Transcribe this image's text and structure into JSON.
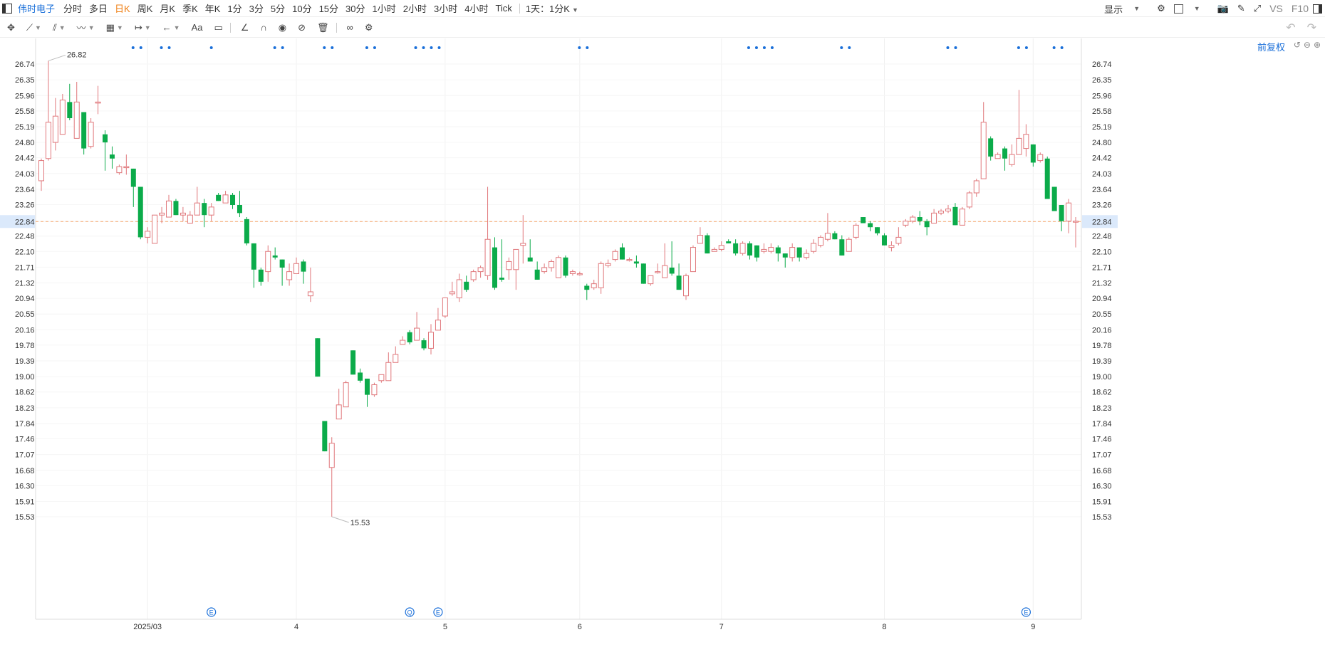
{
  "toolbar": {
    "stock_name": "伟时电子",
    "periods": [
      "分时",
      "多日",
      "日K",
      "周K",
      "月K",
      "季K",
      "年K",
      "1分",
      "3分",
      "5分",
      "10分",
      "15分",
      "30分",
      "1小时",
      "2小时",
      "3小时",
      "4小时",
      "Tick"
    ],
    "active_period": "日K",
    "compare_label": "1天：1分K",
    "display_label": "显示",
    "vs_label": "VS",
    "f10_label": "F10"
  },
  "draw_tools": {
    "text_tool_label": "Aa"
  },
  "adjust_label": "前复权",
  "colors": {
    "up": "#e0777b",
    "down": "#0bab4a",
    "price_line": "#f4a46a",
    "accent": "#1a6fd9",
    "active": "#ef7d10"
  },
  "chart_data": {
    "type": "candlestick",
    "current_price": 22.84,
    "current_price_label": "22.84",
    "high_marker": "26.82",
    "low_marker": "15.53",
    "y_ticks": [
      "26.74",
      "26.35",
      "25.96",
      "25.58",
      "25.19",
      "24.80",
      "24.42",
      "24.03",
      "23.64",
      "23.26",
      "22.84",
      "22.48",
      "22.10",
      "21.71",
      "21.32",
      "20.94",
      "20.55",
      "20.16",
      "19.78",
      "19.39",
      "19.00",
      "18.62",
      "18.23",
      "17.84",
      "17.46",
      "17.07",
      "16.68",
      "16.30",
      "15.91",
      "15.53"
    ],
    "y_range": [
      15.4,
      26.95
    ],
    "x_labels": [
      {
        "label": "2025/03",
        "index": 15
      },
      {
        "label": "4",
        "index": 36
      },
      {
        "label": "5",
        "index": 57
      },
      {
        "label": "6",
        "index": 76
      },
      {
        "label": "7",
        "index": 96
      },
      {
        "label": "8",
        "index": 119
      },
      {
        "label": "9",
        "index": 140
      }
    ],
    "event_markers": [
      {
        "label": "E",
        "index": 24
      },
      {
        "label": "Q",
        "index": 52
      },
      {
        "label": "E",
        "index": 56
      },
      {
        "label": "E",
        "index": 139
      }
    ],
    "dot_groups": [
      [
        13,
        14
      ],
      [
        17,
        18
      ],
      [
        24
      ],
      [
        33,
        34
      ],
      [
        40,
        41
      ],
      [
        46,
        47
      ],
      [
        53,
        54,
        55,
        56
      ],
      [
        76,
        77
      ],
      [
        100,
        101,
        102,
        103
      ],
      [
        113,
        114
      ],
      [
        128,
        129
      ],
      [
        138,
        139
      ],
      [
        143,
        144
      ]
    ],
    "candles": [
      [
        23.85,
        24.35,
        23.6,
        24.4
      ],
      [
        24.4,
        25.3,
        24.35,
        26.82
      ],
      [
        24.8,
        25.45,
        24.6,
        25.9
      ],
      [
        25.0,
        25.85,
        25.0,
        26.0
      ],
      [
        25.8,
        25.4,
        25.35,
        26.25
      ],
      [
        24.9,
        25.8,
        24.9,
        26.3
      ],
      [
        25.55,
        24.65,
        24.5,
        25.55
      ],
      [
        24.7,
        25.3,
        24.65,
        25.4
      ],
      [
        25.8,
        25.8,
        25.5,
        26.2
      ],
      [
        25.0,
        24.8,
        24.1,
        25.1
      ],
      [
        24.5,
        24.4,
        24.15,
        24.7
      ],
      [
        24.05,
        24.2,
        24.0,
        24.25
      ],
      [
        24.2,
        24.2,
        24.0,
        24.5
      ],
      [
        24.15,
        23.7,
        23.2,
        24.15
      ],
      [
        23.7,
        22.45,
        22.4,
        23.7
      ],
      [
        22.45,
        22.6,
        22.3,
        22.7
      ],
      [
        22.3,
        23.0,
        22.3,
        23.0
      ],
      [
        23.0,
        23.05,
        22.8,
        23.2
      ],
      [
        22.95,
        23.35,
        22.95,
        23.5
      ],
      [
        23.35,
        23.0,
        23.0,
        23.4
      ],
      [
        23.0,
        23.05,
        22.85,
        23.2
      ],
      [
        22.8,
        23.0,
        22.8,
        23.1
      ],
      [
        23.0,
        23.3,
        23.0,
        23.7
      ],
      [
        23.3,
        23.0,
        22.7,
        23.4
      ],
      [
        23.0,
        23.2,
        22.85,
        23.3
      ],
      [
        23.5,
        23.35,
        23.35,
        23.55
      ],
      [
        23.3,
        23.5,
        23.3,
        23.6
      ],
      [
        23.5,
        23.25,
        23.15,
        23.55
      ],
      [
        23.25,
        23.05,
        22.95,
        23.6
      ],
      [
        22.9,
        22.3,
        22.25,
        22.95
      ],
      [
        22.3,
        21.65,
        21.2,
        22.3
      ],
      [
        21.65,
        21.35,
        21.25,
        21.7
      ],
      [
        21.6,
        22.1,
        21.35,
        22.25
      ],
      [
        22.0,
        21.95,
        21.9,
        22.2
      ],
      [
        21.9,
        21.7,
        21.25,
        21.9
      ],
      [
        21.4,
        21.6,
        21.25,
        21.8
      ],
      [
        21.55,
        21.8,
        21.55,
        21.95
      ],
      [
        21.85,
        21.6,
        21.3,
        21.9
      ],
      [
        21.0,
        21.1,
        20.85,
        21.7
      ],
      [
        19.95,
        19.0,
        19.0,
        19.95
      ],
      [
        17.9,
        17.15,
        17.15,
        17.9
      ],
      [
        16.75,
        17.35,
        15.53,
        17.5
      ],
      [
        17.95,
        18.3,
        17.95,
        18.7
      ],
      [
        18.25,
        18.85,
        18.25,
        18.9
      ],
      [
        19.65,
        19.05,
        19.05,
        19.65
      ],
      [
        19.1,
        18.9,
        18.85,
        19.2
      ],
      [
        18.95,
        18.55,
        18.25,
        18.95
      ],
      [
        18.55,
        18.8,
        18.5,
        18.85
      ],
      [
        18.9,
        19.05,
        18.85,
        19.05
      ],
      [
        18.9,
        19.35,
        18.9,
        19.6
      ],
      [
        19.35,
        19.55,
        19.35,
        19.75
      ],
      [
        19.8,
        19.9,
        19.8,
        20.0
      ],
      [
        20.1,
        19.85,
        19.8,
        20.15
      ],
      [
        19.9,
        20.2,
        19.9,
        20.6
      ],
      [
        19.9,
        19.7,
        19.65,
        19.95
      ],
      [
        19.7,
        20.1,
        19.55,
        20.3
      ],
      [
        20.15,
        20.4,
        20.15,
        20.7
      ],
      [
        20.5,
        20.95,
        20.45,
        20.95
      ],
      [
        21.05,
        21.1,
        21.0,
        21.35
      ],
      [
        20.95,
        21.4,
        20.85,
        21.55
      ],
      [
        21.35,
        21.15,
        21.1,
        21.5
      ],
      [
        21.4,
        21.6,
        21.35,
        21.65
      ],
      [
        21.6,
        21.7,
        21.45,
        21.75
      ],
      [
        21.5,
        22.4,
        21.4,
        23.7
      ],
      [
        22.2,
        21.2,
        21.15,
        22.45
      ],
      [
        21.45,
        21.4,
        21.35,
        22.4
      ],
      [
        21.65,
        21.85,
        21.4,
        21.95
      ],
      [
        21.65,
        22.15,
        21.15,
        22.15
      ],
      [
        22.25,
        22.3,
        21.8,
        23.0
      ],
      [
        21.95,
        21.85,
        21.85,
        22.4
      ],
      [
        21.65,
        21.4,
        21.4,
        21.85
      ],
      [
        21.6,
        21.7,
        21.55,
        21.8
      ],
      [
        21.7,
        21.85,
        21.6,
        21.9
      ],
      [
        21.45,
        21.95,
        21.45,
        22.0
      ],
      [
        21.95,
        21.5,
        21.45,
        22.0
      ],
      [
        21.55,
        21.6,
        21.5,
        21.65
      ],
      [
        21.55,
        21.55,
        21.5,
        21.6
      ],
      [
        21.25,
        21.15,
        20.9,
        21.3
      ],
      [
        21.2,
        21.3,
        21.15,
        21.4
      ],
      [
        21.2,
        21.8,
        21.05,
        21.85
      ],
      [
        21.75,
        21.8,
        21.7,
        21.9
      ],
      [
        21.9,
        22.1,
        21.85,
        22.15
      ],
      [
        22.2,
        21.9,
        21.9,
        22.3
      ],
      [
        21.9,
        21.9,
        21.85,
        21.95
      ],
      [
        21.85,
        21.8,
        21.7,
        22.0
      ],
      [
        21.8,
        21.3,
        21.3,
        21.8
      ],
      [
        21.3,
        21.5,
        21.25,
        21.5
      ],
      [
        21.6,
        21.6,
        21.55,
        21.8
      ],
      [
        21.45,
        21.75,
        21.45,
        22.3
      ],
      [
        21.7,
        21.55,
        21.5,
        22.35
      ],
      [
        21.5,
        21.15,
        21.15,
        21.8
      ],
      [
        21.0,
        21.5,
        20.9,
        21.55
      ],
      [
        21.6,
        22.2,
        21.6,
        22.25
      ],
      [
        22.3,
        22.5,
        22.3,
        22.7
      ],
      [
        22.5,
        22.05,
        22.05,
        22.55
      ],
      [
        22.1,
        22.15,
        22.1,
        22.2
      ],
      [
        22.15,
        22.25,
        22.1,
        22.35
      ],
      [
        22.35,
        22.3,
        22.3,
        22.4
      ],
      [
        22.3,
        22.05,
        22.0,
        22.4
      ],
      [
        22.05,
        22.3,
        22.0,
        22.35
      ],
      [
        22.3,
        22.0,
        21.9,
        22.35
      ],
      [
        22.25,
        21.95,
        21.85,
        22.25
      ],
      [
        22.1,
        22.15,
        22.05,
        22.3
      ],
      [
        22.1,
        22.2,
        22.05,
        22.3
      ],
      [
        22.2,
        22.05,
        21.85,
        22.25
      ],
      [
        22.05,
        21.95,
        21.7,
        22.05
      ],
      [
        21.95,
        22.2,
        21.85,
        22.3
      ],
      [
        22.2,
        21.95,
        21.85,
        22.2
      ],
      [
        21.95,
        22.05,
        21.9,
        22.15
      ],
      [
        22.1,
        22.3,
        22.05,
        22.4
      ],
      [
        22.25,
        22.45,
        22.2,
        22.5
      ],
      [
        22.4,
        22.55,
        22.35,
        23.05
      ],
      [
        22.55,
        22.4,
        22.4,
        22.6
      ],
      [
        22.4,
        22.0,
        22.0,
        22.5
      ],
      [
        22.1,
        22.4,
        22.1,
        22.45
      ],
      [
        22.45,
        22.75,
        22.4,
        22.8
      ],
      [
        22.95,
        22.8,
        22.8,
        22.95
      ],
      [
        22.8,
        22.7,
        22.6,
        22.85
      ],
      [
        22.7,
        22.55,
        22.5,
        22.7
      ],
      [
        22.5,
        22.25,
        22.25,
        22.55
      ],
      [
        22.2,
        22.25,
        22.1,
        22.35
      ],
      [
        22.3,
        22.45,
        22.25,
        22.7
      ],
      [
        22.75,
        22.85,
        22.7,
        22.9
      ],
      [
        22.85,
        22.95,
        22.8,
        23.0
      ],
      [
        22.95,
        22.85,
        22.75,
        23.1
      ],
      [
        22.85,
        22.7,
        22.5,
        22.9
      ],
      [
        22.8,
        23.05,
        22.8,
        23.15
      ],
      [
        23.05,
        23.1,
        23.0,
        23.15
      ],
      [
        23.1,
        23.15,
        23.05,
        23.25
      ],
      [
        23.2,
        22.75,
        22.75,
        23.3
      ],
      [
        22.75,
        23.15,
        22.75,
        23.2
      ],
      [
        23.2,
        23.55,
        23.15,
        23.6
      ],
      [
        23.55,
        23.85,
        23.45,
        23.9
      ],
      [
        23.9,
        25.3,
        23.9,
        25.8
      ],
      [
        24.9,
        24.45,
        24.35,
        24.95
      ],
      [
        24.4,
        24.5,
        24.4,
        24.55
      ],
      [
        24.65,
        24.4,
        24.1,
        24.7
      ],
      [
        24.25,
        24.5,
        24.2,
        24.75
      ],
      [
        24.5,
        24.9,
        24.5,
        26.1
      ],
      [
        24.65,
        25.0,
        24.45,
        25.25
      ],
      [
        24.75,
        24.3,
        24.2,
        24.75
      ],
      [
        24.35,
        24.5,
        24.3,
        24.55
      ],
      [
        24.4,
        23.4,
        23.4,
        24.45
      ],
      [
        23.7,
        23.1,
        23.1,
        23.7
      ],
      [
        23.25,
        22.85,
        22.6,
        23.25
      ],
      [
        22.85,
        23.3,
        22.55,
        23.4
      ],
      [
        22.85,
        22.85,
        22.2,
        22.95
      ]
    ]
  }
}
